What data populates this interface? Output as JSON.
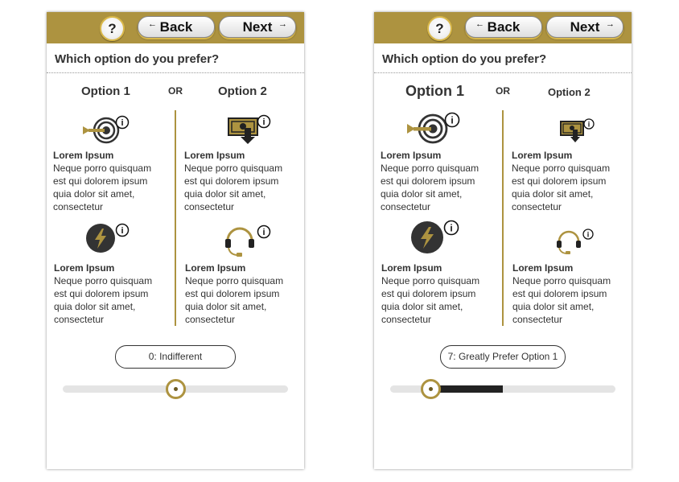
{
  "colors": {
    "header_bar": "#ad9340",
    "accent_gold": "#d9b84a",
    "divider": "#ad9340",
    "slider_fill": "#222222",
    "slider_track": "#e4e4e4"
  },
  "screens": [
    {
      "toolbar": {
        "help_label": "?",
        "back_label": "Back",
        "next_label": "Next",
        "back_arrow": "←",
        "next_arrow": "→"
      },
      "question": "Which option do you prefer?",
      "option1_title": "Option 1",
      "or_label": "OR",
      "option2_title": "Option 2",
      "info_glyph": "i",
      "items": [
        {
          "icon": "target-arrow-icon",
          "title": "Lorem Ipsum",
          "desc": "Neque porro quisquam est qui dolorem ipsum quia dolor sit amet, consectetur"
        },
        {
          "icon": "money-download-icon",
          "title": "Lorem Ipsum",
          "desc": "Neque porro quisquam est qui dolorem ipsum quia dolor sit amet, consectetur"
        },
        {
          "icon": "lightning-icon",
          "title": "Lorem Ipsum",
          "desc": "Neque porro quisquam est qui dolorem ipsum quia dolor sit amet, consectetur"
        },
        {
          "icon": "headset-icon",
          "title": "Lorem Ipsum",
          "desc": "Neque porro quisquam est qui dolorem ipsum quia dolor sit amet, consectetur"
        }
      ],
      "slider": {
        "label": "0: Indifferent",
        "value_fraction": 0.5,
        "fill_from": 0.5
      }
    },
    {
      "toolbar": {
        "help_label": "?",
        "back_label": "Back",
        "next_label": "Next",
        "back_arrow": "←",
        "next_arrow": "→"
      },
      "question": "Which option do you prefer?",
      "option1_title": "Option 1",
      "or_label": "OR",
      "option2_title": "Option 2",
      "info_glyph": "i",
      "items": [
        {
          "icon": "target-arrow-icon",
          "title": "Lorem Ipsum",
          "desc": "Neque porro quisquam est qui dolorem ipsum quia dolor sit amet, consectetur"
        },
        {
          "icon": "money-download-icon",
          "title": "Lorem Ipsum",
          "desc": "Neque porro quisquam est qui dolorem ipsum quia dolor sit amet, consectetur"
        },
        {
          "icon": "lightning-icon",
          "title": "Lorem Ipsum",
          "desc": "Neque porro quisquam est qui dolorem ipsum quia dolor sit amet, consectetur"
        },
        {
          "icon": "headset-icon",
          "title": "Lorem Ipsum",
          "desc": "Neque porro quisquam est qui dolorem ipsum quia dolor sit amet, consectetur"
        }
      ],
      "slider": {
        "label": "7: Greatly Prefer Option 1",
        "value_fraction": 0.18,
        "fill_from": 0.5
      }
    }
  ]
}
